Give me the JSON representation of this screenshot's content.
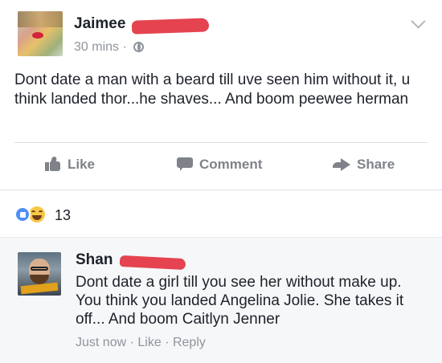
{
  "post": {
    "author": "Jaimee",
    "timestamp": "30 mins",
    "privacy_icon": "globe-icon",
    "text": "Dont date a man with a beard till uve seen him without it, u think landed thor...he shaves... And boom peewee herman",
    "actions": {
      "like": "Like",
      "comment": "Comment",
      "share": "Share"
    }
  },
  "reactions": {
    "types": [
      "like",
      "haha"
    ],
    "count": "13"
  },
  "comment": {
    "author": "Shan",
    "text": "Dont date a girl till you see her without make up. You think you landed Angelina Jolie. She takes it off... And boom Caitlyn Jenner",
    "time": "Just now",
    "like": "Like",
    "reply": "Reply"
  },
  "colors": {
    "redaction": "#e4434f",
    "like_blue": "#4f8ef7",
    "haha_yellow": "#f7c846",
    "meta_gray": "#90949c"
  }
}
